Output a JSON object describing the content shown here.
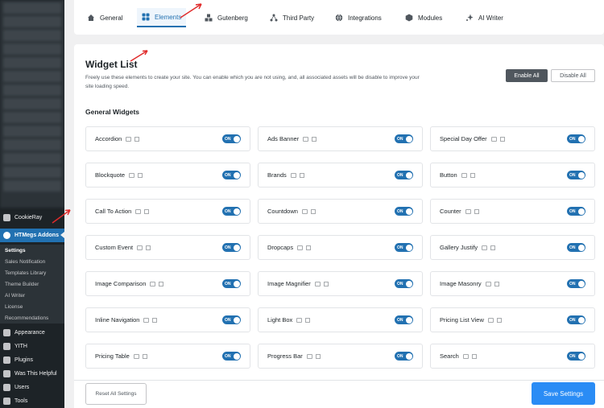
{
  "sidebar": {
    "blurred_count": 14,
    "items": [
      {
        "label": "CookieRay",
        "icon": "shield-icon"
      },
      {
        "label": "HTMegs Addons",
        "icon": "htmegs-icon"
      },
      {
        "label": "Appearance",
        "icon": "paintbrush-icon"
      },
      {
        "label": "YITH",
        "icon": "yith-icon"
      },
      {
        "label": "Plugins",
        "icon": "plug-icon"
      },
      {
        "label": "Was This Helpful",
        "icon": "thumb-icon"
      },
      {
        "label": "Users",
        "icon": "users-icon"
      },
      {
        "label": "Tools",
        "icon": "wrench-icon"
      }
    ],
    "submenu": [
      "Settings",
      "Sales Notification",
      "Templates Library",
      "Theme Builder",
      "AI Writer",
      "License",
      "Recommendations"
    ]
  },
  "tabs": [
    {
      "label": "General",
      "icon": "home-icon"
    },
    {
      "label": "Elements",
      "icon": "grid-icon"
    },
    {
      "label": "Gutenberg",
      "icon": "blocks-icon"
    },
    {
      "label": "Third Party",
      "icon": "network-icon"
    },
    {
      "label": "Integrations",
      "icon": "globe-icon"
    },
    {
      "label": "Modules",
      "icon": "cube-icon"
    },
    {
      "label": "AI Writer",
      "icon": "sparkle-icon"
    }
  ],
  "header": {
    "title": "Widget List",
    "description": "Freely use these elements to create your site. You can enable which you are not using, and, all associated assets will be disable to improve your site loading speed.",
    "enable_all": "Enable All",
    "disable_all": "Disable All"
  },
  "section_title": "General Widgets",
  "widgets": [
    {
      "label": "Accordion",
      "state": "ON"
    },
    {
      "label": "Ads Banner",
      "state": "ON"
    },
    {
      "label": "Special Day Offer",
      "state": "ON"
    },
    {
      "label": "Blockquote",
      "state": "ON"
    },
    {
      "label": "Brands",
      "state": "ON"
    },
    {
      "label": "Button",
      "state": "ON"
    },
    {
      "label": "Call To Action",
      "state": "ON"
    },
    {
      "label": "Countdown",
      "state": "ON"
    },
    {
      "label": "Counter",
      "state": "ON"
    },
    {
      "label": "Custom Event",
      "state": "ON"
    },
    {
      "label": "Dropcaps",
      "state": "ON"
    },
    {
      "label": "Gallery Justify",
      "state": "ON"
    },
    {
      "label": "Image Comparison",
      "state": "ON"
    },
    {
      "label": "Image Magnifier",
      "state": "ON"
    },
    {
      "label": "Image Masonry",
      "state": "ON"
    },
    {
      "label": "Inline Navigation",
      "state": "ON"
    },
    {
      "label": "Light Box",
      "state": "ON"
    },
    {
      "label": "Pricing List View",
      "state": "ON"
    },
    {
      "label": "Pricing Table",
      "state": "ON"
    },
    {
      "label": "Progress Bar",
      "state": "ON"
    },
    {
      "label": "Search",
      "state": "ON"
    }
  ],
  "footer": {
    "reset": "Reset All Settings",
    "save": "Save Settings"
  },
  "colors": {
    "accent": "#2271b1",
    "save": "#2a8cf5",
    "sidebar": "#1d2327",
    "arrow": "#e02b2b"
  }
}
